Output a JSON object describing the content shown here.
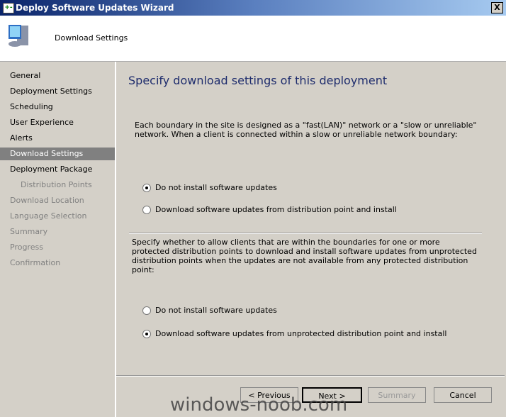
{
  "window": {
    "title": "Deploy Software Updates Wizard",
    "close": "X"
  },
  "header": {
    "title": "Download Settings",
    "icon": "computer-icon"
  },
  "sidebar": {
    "items": [
      {
        "label": "General",
        "state": "normal"
      },
      {
        "label": "Deployment Settings",
        "state": "normal"
      },
      {
        "label": "Scheduling",
        "state": "normal"
      },
      {
        "label": "User Experience",
        "state": "normal"
      },
      {
        "label": "Alerts",
        "state": "normal"
      },
      {
        "label": "Download Settings",
        "state": "selected"
      },
      {
        "label": "Deployment Package",
        "state": "normal"
      },
      {
        "label": "Distribution Points",
        "state": "disabled",
        "indent": true
      },
      {
        "label": "Download Location",
        "state": "disabled"
      },
      {
        "label": "Language Selection",
        "state": "disabled"
      },
      {
        "label": "Summary",
        "state": "disabled"
      },
      {
        "label": "Progress",
        "state": "disabled"
      },
      {
        "label": "Confirmation",
        "state": "disabled"
      }
    ]
  },
  "main": {
    "heading": "Specify download settings of this deployment",
    "para1": "Each boundary in the site is designed as a \"fast(LAN)\" network or a \"slow or unreliable\" network. When a client is connected within a slow or unreliable network boundary:",
    "group1": [
      {
        "label": "Do not install software updates",
        "checked": true
      },
      {
        "label": "Download software updates from distribution point and install",
        "checked": false
      }
    ],
    "para2": "Specify whether to allow clients that are within the boundaries for one or more protected distribution points to download and install software updates from unprotected distribution points when the updates are not available from any protected distribution point:",
    "group2": [
      {
        "label": "Do not install software updates",
        "checked": false
      },
      {
        "label": "Download software updates from unprotected distribution point and install",
        "checked": true
      }
    ]
  },
  "buttons": {
    "previous": "< Previous",
    "next": "Next >",
    "summary": "Summary",
    "cancel": "Cancel"
  },
  "watermark": "windows-noob.com"
}
